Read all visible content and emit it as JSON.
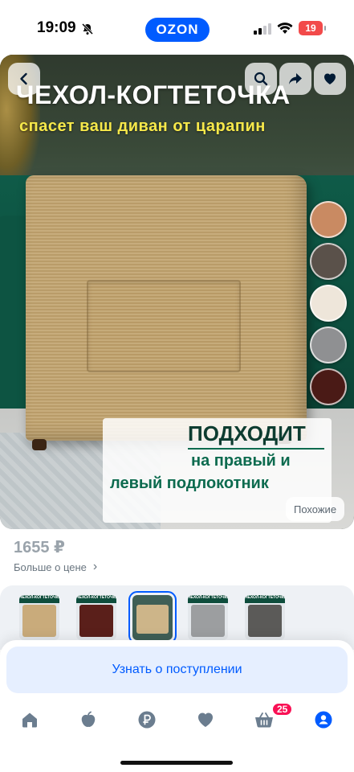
{
  "status_bar": {
    "time": "19:09",
    "brand": "OZON",
    "battery": "19",
    "icons": [
      "bell-off-icon",
      "signal-icon",
      "wifi-icon",
      "battery-icon"
    ]
  },
  "product_image": {
    "headline": "ЧЕХОЛ-КОГТЕТОЧКА",
    "subheadline": "спасет ваш диван от царапин",
    "fit_title": "ПОДХОДИТ",
    "fit_line1": "на правый и",
    "fit_line2": "левый подлокотник",
    "similar_label": "Похожие",
    "swatches": [
      "#c98a62",
      "#5a514a",
      "#eee6da",
      "#8f9092",
      "#4a1a16"
    ],
    "top_icons": [
      "back-icon",
      "search-icon",
      "share-icon",
      "heart-icon"
    ]
  },
  "price": {
    "value": "1655 ₽",
    "more_label": "Больше о цене"
  },
  "thumbnails": [
    {
      "label": "ЧЕХОЛ-КОГТЕТОЧКА",
      "color": "#c9ab7b",
      "selected": false
    },
    {
      "label": "ЧЕХОЛ-КОГТЕТОЧКА",
      "color": "#5a1f1a",
      "selected": false
    },
    {
      "label": "",
      "color": "#cdb589",
      "selected": true
    },
    {
      "label": "ЧЕХОЛ-КОГТЕТОЧКА",
      "color": "#9c9ea0",
      "selected": false
    },
    {
      "label": "ЧЕХОЛ-КОГТЕТОЧКА",
      "color": "#5b5a58",
      "selected": false
    }
  ],
  "cta": {
    "notify_label": "Узнать о поступлении"
  },
  "tabbar": {
    "items": [
      "home-icon",
      "fresh-icon",
      "ruble-icon",
      "favorites-icon",
      "cart-icon",
      "profile-icon"
    ],
    "cart_count": "25",
    "accent": "#005bff"
  }
}
